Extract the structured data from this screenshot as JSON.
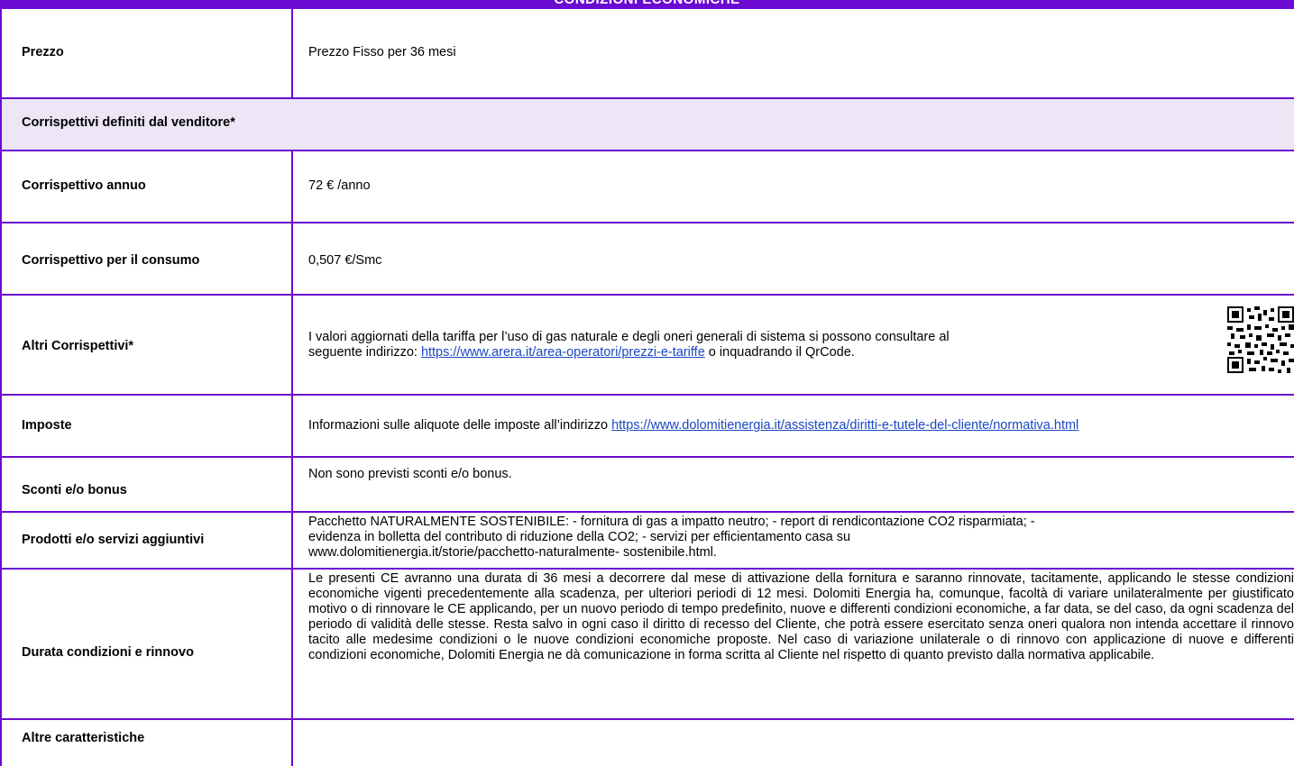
{
  "header": {
    "title": "CONDIZIONI ECONOMICHE"
  },
  "rows": {
    "prezzo": {
      "label": "Prezzo",
      "value": "Prezzo Fisso  per 36 mesi"
    },
    "corrispettivi_venditore": {
      "label": "Corrispettivi definiti dal venditore*"
    },
    "corrispettivo_annuo": {
      "label": "Corrispettivo annuo",
      "value": "72 € /anno"
    },
    "corrispettivo_consumo": {
      "label": "Corrispettivo per il consumo",
      "value": "0,507 €/Smc"
    },
    "altri_corrispettivi": {
      "label": "Altri Corrispettivi*",
      "text_1": "I valori aggiornati della tariffa per l’uso di gas naturale e degli oneri generali di sistema si possono consultare al",
      "text_2_prefix": "seguente indirizzo: ",
      "link": "https://www.arera.it/area-operatori/prezzi-e-tariffe",
      "text_2_suffix": " o inquadrando il QrCode."
    },
    "imposte": {
      "label": "Imposte",
      "text_prefix": "Informazioni sulle aliquote delle imposte all’indirizzo ",
      "link": "https://www.dolomitienergia.it/assistenza/diritti-e-tutele-del-cliente/normativa.html"
    },
    "sconti": {
      "label": "Sconti e/o bonus",
      "value": "Non sono previsti sconti e/o bonus."
    },
    "prodotti": {
      "label": "Prodotti e/o servizi aggiuntivi",
      "line_1": "Pacchetto NATURALMENTE SOSTENIBILE: - fornitura di gas a impatto neutro; - report di rendicontazione CO2 risparmiata; -",
      "line_2": "evidenza in bolletta del contributo di riduzione della CO2; - servizi per efficientamento casa su",
      "line_3": "www.dolomitienergia.it/storie/pacchetto-naturalmente- sostenibile.html."
    },
    "durata": {
      "label": "Durata condizioni e rinnovo",
      "text": "Le presenti CE avranno una durata di 36 mesi a decorrere dal mese di attivazione della fornitura  e saranno rinnovate, tacitamente, applicando le stesse condizioni economiche vigenti precedentemente alla scadenza, per ulteriori periodi di 12 mesi. Dolomiti Energia ha, comunque, facoltà di variare unilateralmente per giustificato motivo o di rinnovare le CE applicando, per un nuovo periodo di tempo predefinito, nuove e differenti condizioni economiche, a far data, se del caso, da ogni scadenza del periodo di validità delle stesse. Resta salvo in ogni caso il diritto di recesso del Cliente, che potrà essere esercitato senza oneri qualora non intenda accettare il rinnovo tacito alle medesime condizioni o le nuove condizioni economiche proposte. Nel caso di variazione unilaterale o di rinnovo con applicazione di nuove e differenti condizioni economiche, Dolomiti Energia ne dà comunicazione in forma scritta al Cliente nel rispetto di quanto previsto dalla normativa applicabile."
    },
    "altre": {
      "label": "Altre caratteristiche"
    }
  },
  "colors": {
    "accent": "#6B0AD1",
    "highlight_row": "#ECE6F6",
    "link": "#1a47c2"
  },
  "icons": {
    "qr": "qr-code-icon"
  }
}
